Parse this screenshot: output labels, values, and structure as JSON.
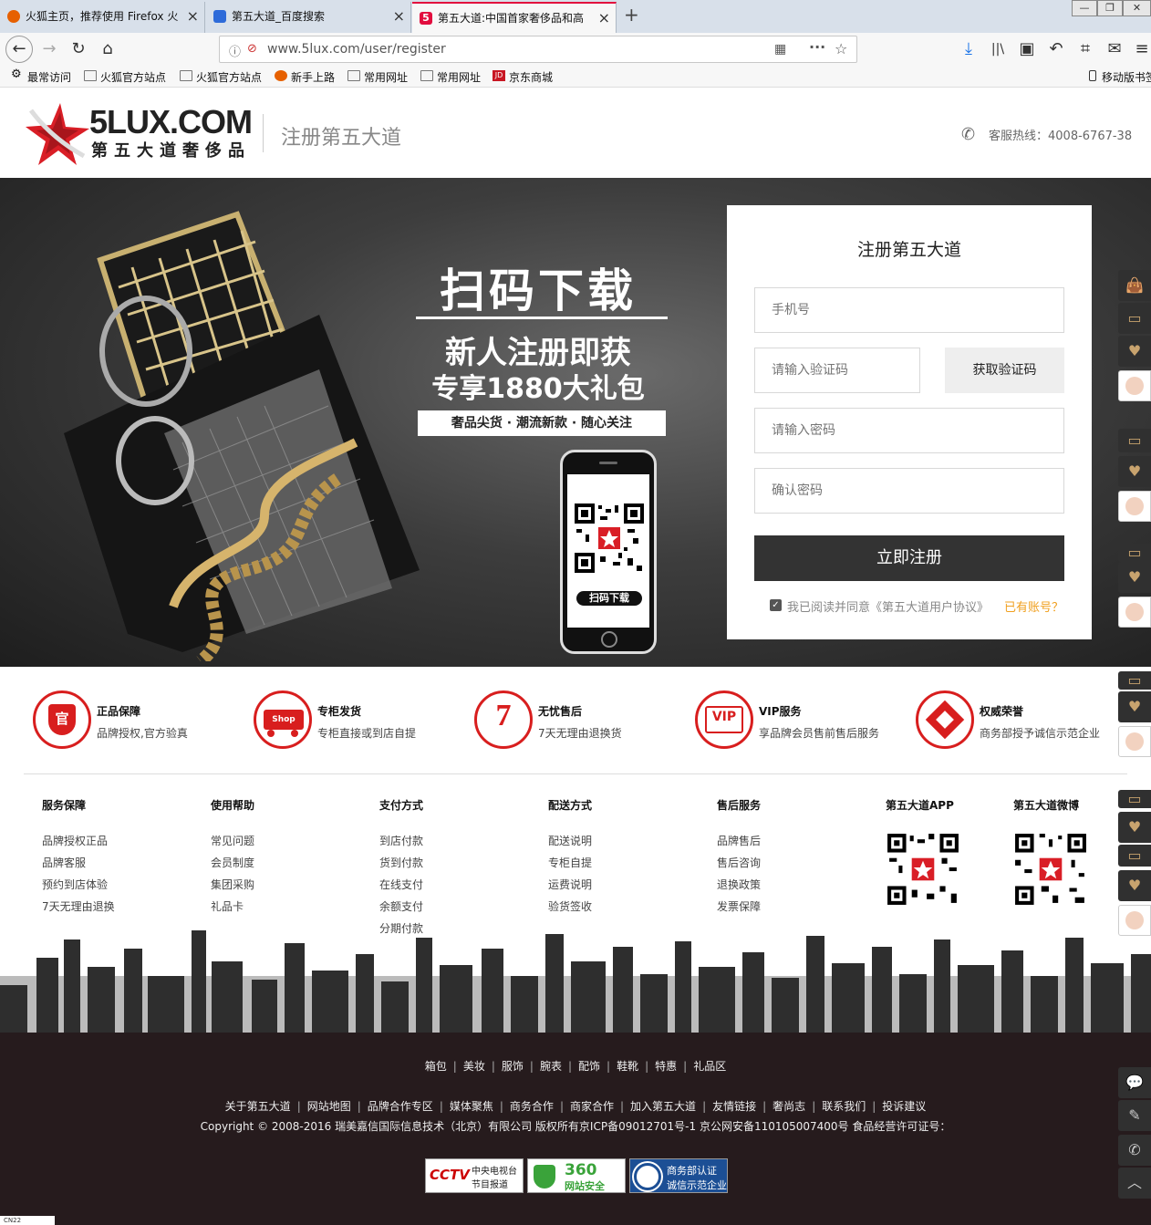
{
  "browser": {
    "tabs": [
      {
        "label": "火狐主页，推荐使用 Firefox 火",
        "color": "#e66000"
      },
      {
        "label": "第五大道_百度搜索",
        "color": "#2e6bd9"
      },
      {
        "label": "第五大道:中国首家奢侈品和高",
        "color": "#e20d3e"
      }
    ],
    "url": "www.5lux.com/user/register",
    "bookmarks": [
      "最常访问",
      "火狐官方站点",
      "火狐官方站点",
      "新手上路",
      "常用网址",
      "常用网址",
      "京东商城"
    ],
    "mobile_bookmarks": "移动版书签"
  },
  "header": {
    "logo_text": "5LUX.COM",
    "logo_sub": "第五大道奢侈品",
    "page_title": "注册第五大道",
    "hotline": "客服热线：4008-6767-38"
  },
  "banner": {
    "headline": "扫码下载",
    "line1": "新人注册即获",
    "line2": "专享1880大礼包",
    "tagline": "奢品尖货 · 潮流新款 · 随心关注",
    "phone_label": "扫码下载"
  },
  "register_form": {
    "title": "注册第五大道",
    "phone_placeholder": "手机号",
    "code_placeholder": "请输入验证码",
    "get_code": "获取验证码",
    "password_placeholder": "请输入密码",
    "confirm_placeholder": "确认密码",
    "submit": "立即注册",
    "agree_text": "我已阅读并同意《第五大道用户协议》",
    "has_account": "已有账号？"
  },
  "features": [
    {
      "icon": "官",
      "title": "正品保障",
      "desc": "品牌授权,官方验真"
    },
    {
      "icon": "Shop",
      "title": "专柜发货",
      "desc": "专柜直接或到店自提"
    },
    {
      "icon": "7",
      "title": "无忧售后",
      "desc": "7天无理由退换货"
    },
    {
      "icon": "VIP",
      "title": "VIP服务",
      "desc": "享品牌会员售前售后服务"
    },
    {
      "icon": "◆",
      "title": "权威荣誉",
      "desc": "商务部授予诚信示范企业"
    }
  ],
  "footer_columns": [
    {
      "title": "服务保障",
      "links": [
        "品牌授权正品",
        "品牌客服",
        "预约到店体验",
        "7天无理由退换"
      ]
    },
    {
      "title": "使用帮助",
      "links": [
        "常见问题",
        "会员制度",
        "集团采购",
        "礼品卡"
      ]
    },
    {
      "title": "支付方式",
      "links": [
        "到店付款",
        "货到付款",
        "在线支付",
        "余额支付",
        "分期付款"
      ]
    },
    {
      "title": "配送方式",
      "links": [
        "配送说明",
        "专柜自提",
        "运费说明",
        "验货签收"
      ]
    },
    {
      "title": "售后服务",
      "links": [
        "品牌售后",
        "售后咨询",
        "退换政策",
        "发票保障"
      ]
    }
  ],
  "app": {
    "title": "第五大道APP"
  },
  "weibo": {
    "title": "第五大道微博"
  },
  "bottom": {
    "categories": [
      "箱包",
      "美妆",
      "服饰",
      "腕表",
      "配饰",
      "鞋靴",
      "特惠",
      "礼品区"
    ],
    "links": [
      "关于第五大道",
      "网站地图",
      "品牌合作专区",
      "媒体聚焦",
      "商务合作",
      "商家合作",
      "加入第五大道",
      "友情链接",
      "奢尚志",
      "联系我们",
      "投诉建议"
    ],
    "copyright": "Copyright © 2008-2016 瑞美嘉信国际信息技术（北京）有限公司 版权所有京ICP备09012701号-1 京公网安备110105007400号 食品经营许可证号：",
    "badges": [
      {
        "main": "CCTV",
        "sub1": "中央电视台",
        "sub2": "节目报道"
      },
      {
        "main": "360",
        "sub1": "网站安全"
      },
      {
        "main": "商务部认证",
        "sub1": "诚信示范企业"
      }
    ]
  },
  "statusbar": "CN22",
  "colors": {
    "accent": "#d81e1e",
    "gold": "#f0a020",
    "dark": "#333333",
    "footer": "#261b1d"
  }
}
